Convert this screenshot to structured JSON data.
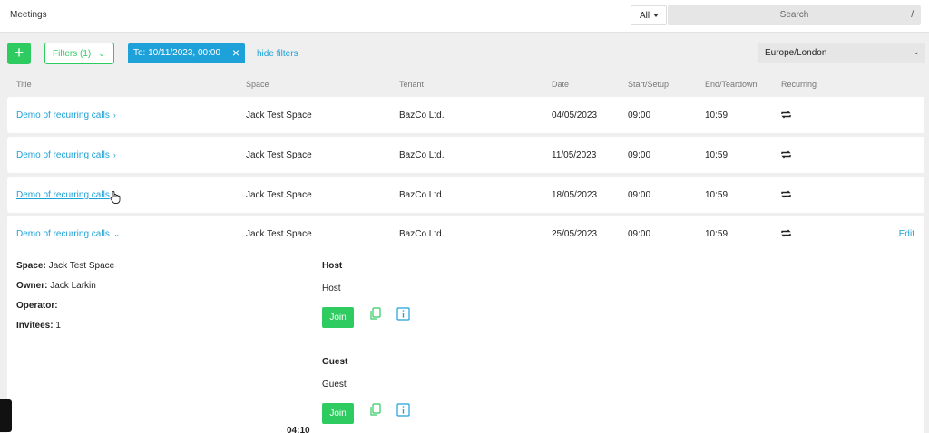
{
  "header": {
    "title": "Meetings",
    "scope": "All",
    "search_placeholder": "Search",
    "search_shortcut": "/"
  },
  "toolbar": {
    "add_label": "+",
    "filters_label": "Filters (1)",
    "chip_label": "To: 10/11/2023, 00:00",
    "hide_filters": "hide filters",
    "timezone": "Europe/London"
  },
  "columns": [
    "Title",
    "Space",
    "Tenant",
    "Date",
    "Start/Setup",
    "End/Teardown",
    "Recurring"
  ],
  "rows": [
    {
      "title": "Demo of recurring calls",
      "space": "Jack Test Space",
      "tenant": "BazCo Ltd.",
      "date": "04/05/2023",
      "start": "09:00",
      "end": "10:59"
    },
    {
      "title": "Demo of recurring calls",
      "space": "Jack Test Space",
      "tenant": "BazCo Ltd.",
      "date": "11/05/2023",
      "start": "09:00",
      "end": "10:59"
    },
    {
      "title": "Demo of recurring calls",
      "space": "Jack Test Space",
      "tenant": "BazCo Ltd.",
      "date": "18/05/2023",
      "start": "09:00",
      "end": "10:59"
    },
    {
      "title": "Demo of recurring calls",
      "space": "Jack Test Space",
      "tenant": "BazCo Ltd.",
      "date": "25/05/2023",
      "start": "09:00",
      "end": "10:59",
      "edit": "Edit"
    }
  ],
  "details": {
    "space_label": "Space:",
    "space": "Jack Test Space",
    "owner_label": "Owner:",
    "owner": "Jack Larkin",
    "operator_label": "Operator:",
    "invitees_label": "Invitees:",
    "invitees": "1",
    "host_title": "Host",
    "host_sub": "Host",
    "guest_title": "Guest",
    "guest_sub": "Guest",
    "join_label": "Join",
    "partial_time": "04:10"
  },
  "icons": {
    "add": "plus-icon",
    "copy": "copy-icon",
    "info": "info-icon",
    "recurring": "repeat-icon"
  },
  "colors": {
    "accent": "#1da1d8",
    "success": "#2ecc60"
  }
}
